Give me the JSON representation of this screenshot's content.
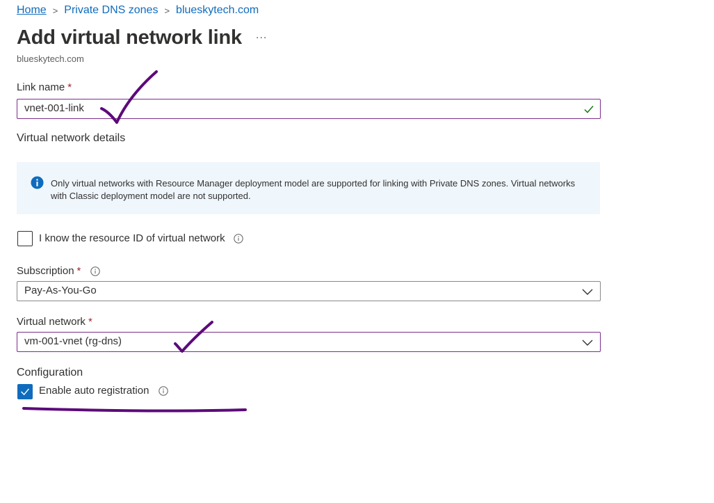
{
  "breadcrumb": {
    "items": [
      "Home",
      "Private DNS zones",
      "blueskytech.com"
    ],
    "separator": ">"
  },
  "header": {
    "title": "Add virtual network link",
    "more_label": "...",
    "subtitle": "blueskytech.com"
  },
  "form": {
    "link_name": {
      "label": "Link name",
      "required_mark": "*",
      "value": "vnet-001-link",
      "valid": true
    },
    "vnet_details_heading": "Virtual network details",
    "info_message": "Only virtual networks with Resource Manager deployment model are supported for linking with Private DNS zones. Virtual networks with Classic deployment model are not supported.",
    "resource_id_checkbox": {
      "label": "I know the resource ID of virtual network",
      "checked": false
    },
    "subscription": {
      "label": "Subscription",
      "required_mark": "*",
      "value": "Pay-As-You-Go"
    },
    "virtual_network": {
      "label": "Virtual network",
      "required_mark": "*",
      "value": "vm-001-vnet (rg-dns)"
    },
    "configuration_heading": "Configuration",
    "auto_registration": {
      "label": "Enable auto registration",
      "checked": true
    }
  },
  "colors": {
    "link": "#0f6cbd",
    "required": "#a4262c",
    "info_bg": "#eff6fc",
    "valid_check": "#107c10",
    "annotation": "#5c0a7a"
  }
}
